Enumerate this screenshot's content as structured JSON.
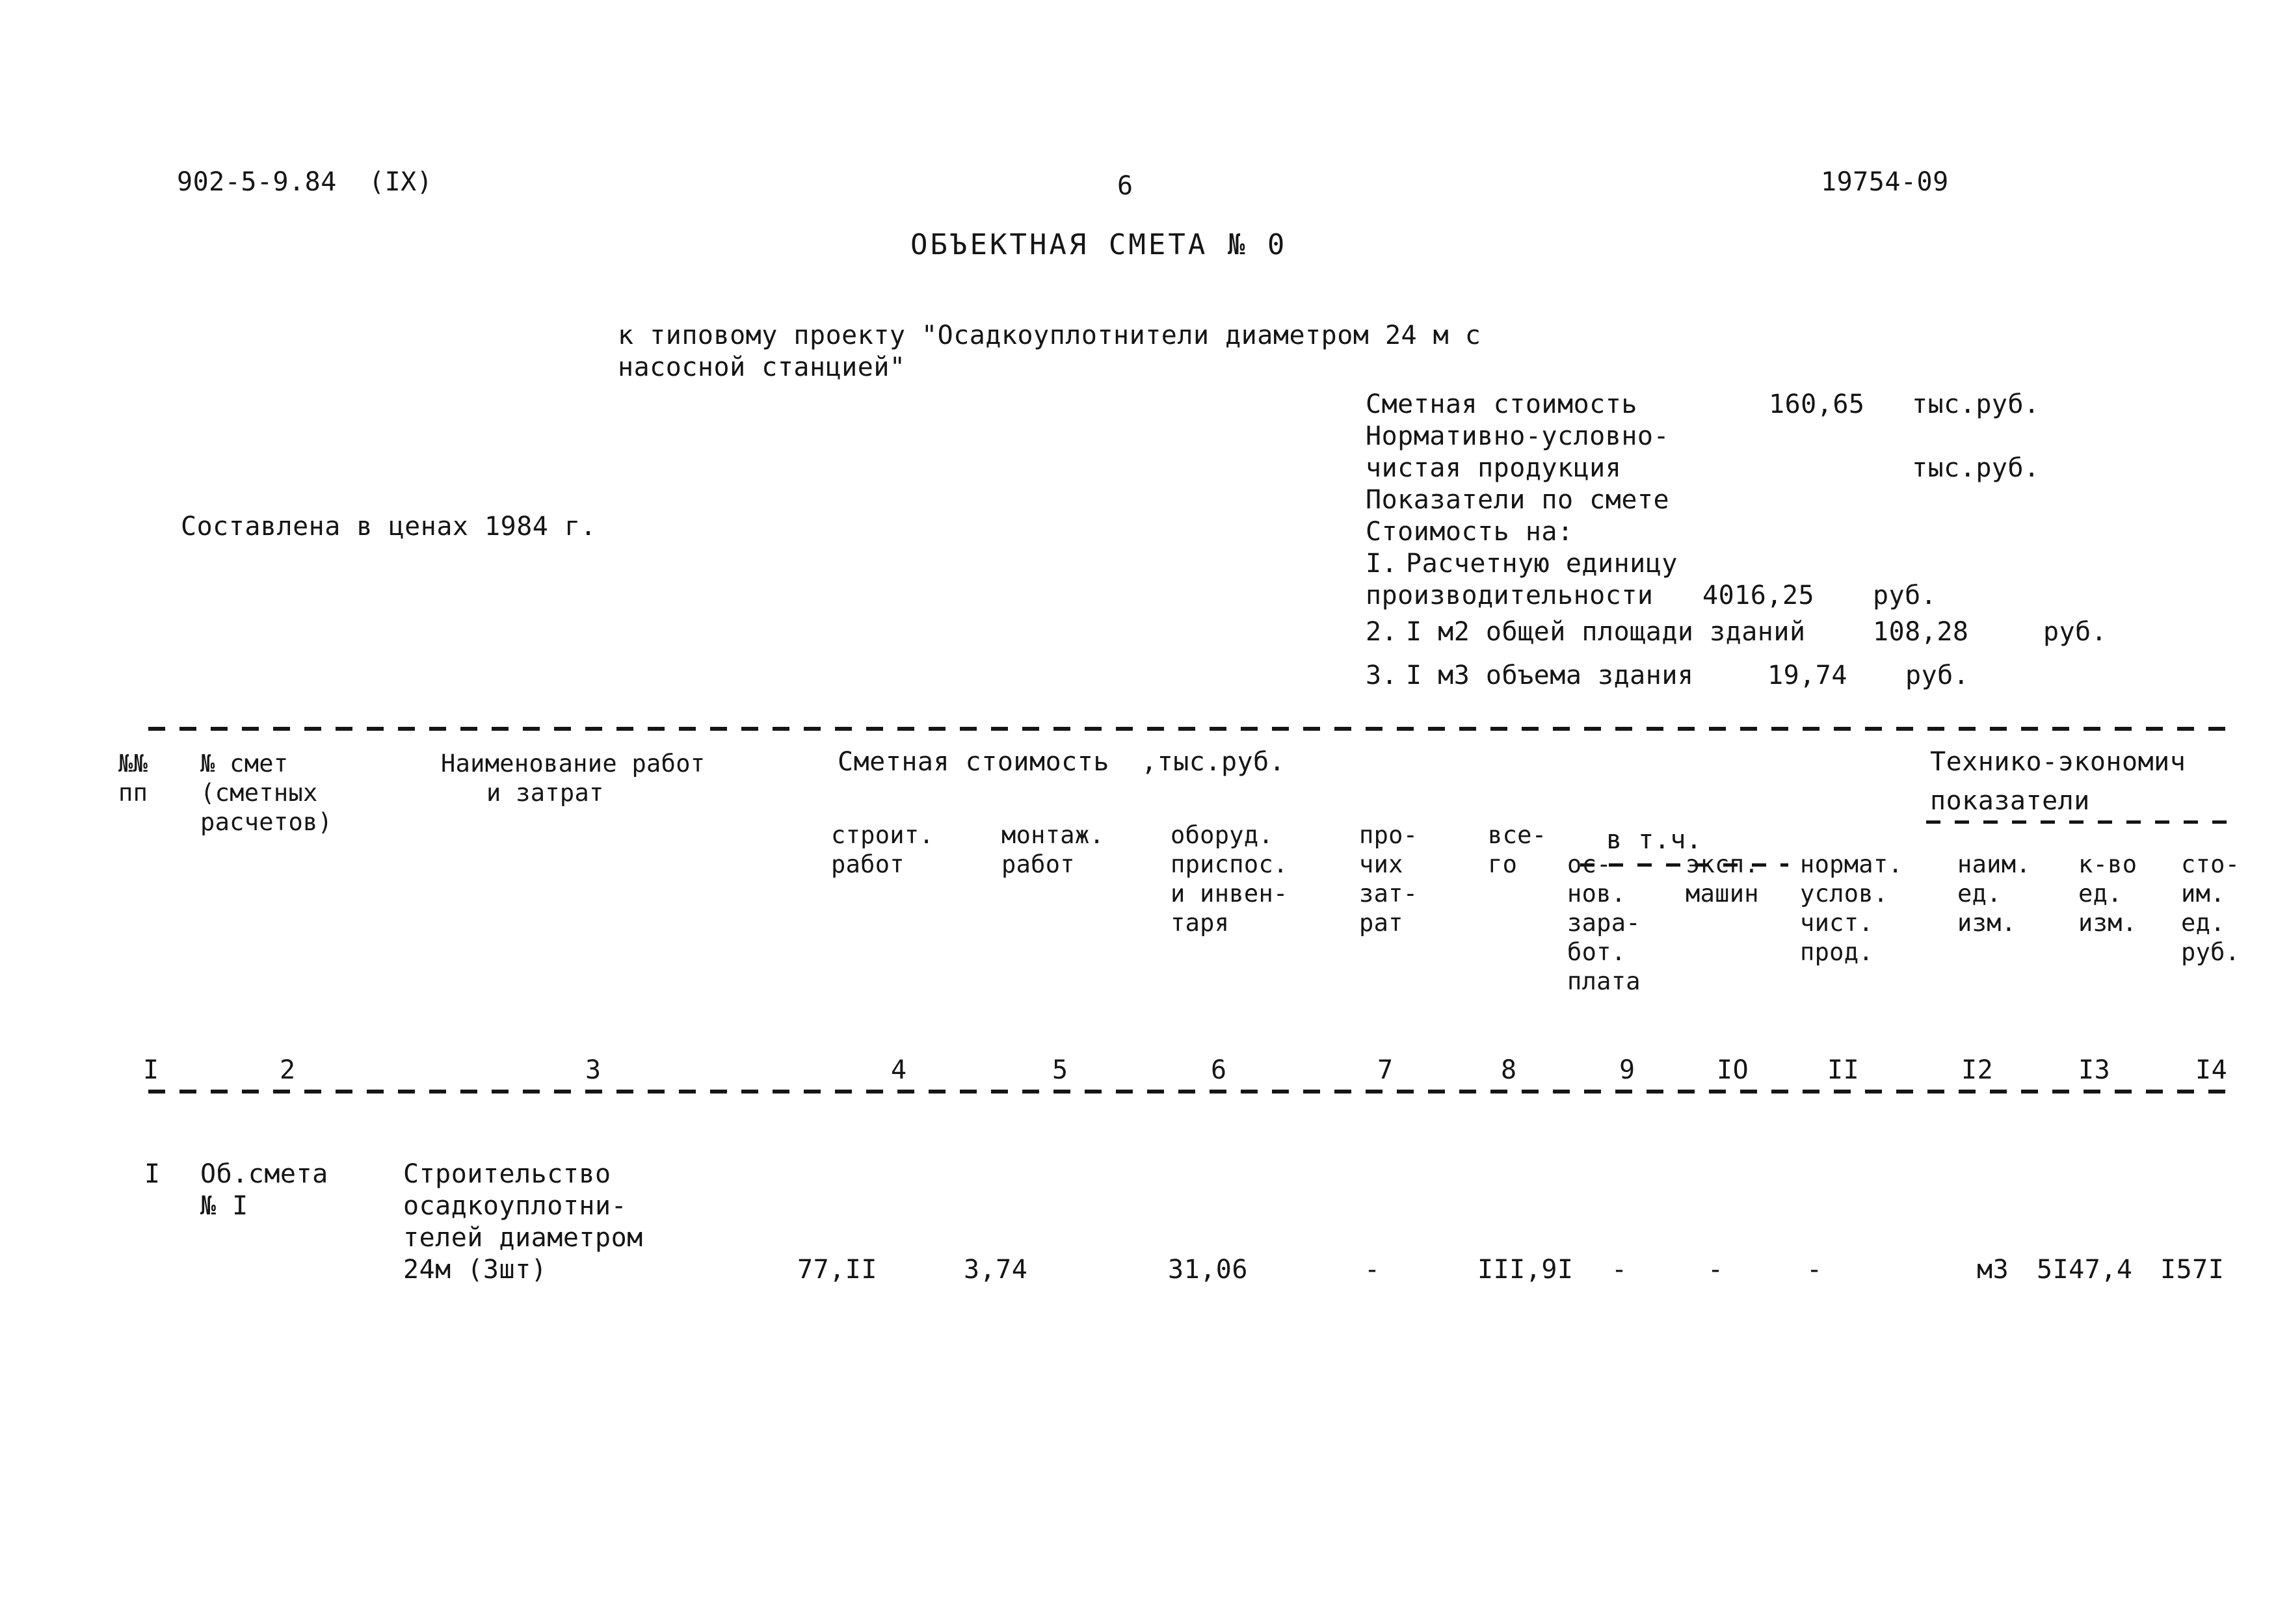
{
  "header": {
    "doc_code": "902-5-9.84  (IX)",
    "page_number": "6",
    "archive_code": "19754-09",
    "title": "ОБЪЕКТНАЯ СМЕТА № 0",
    "subtitle_line1": "к типовому проекту \"Осадкоуплотнители диаметром 24 м с",
    "subtitle_line2": "насосной станцией\"",
    "prices_note": "Составлена в ценах 1984 г."
  },
  "summary": {
    "estimate_cost_label": "Сметная стоимость",
    "estimate_cost_value": "160,65",
    "estimate_cost_unit": "тыс.руб.",
    "nucp_label_line1": "Нормативно-условно-",
    "nucp_label_line2": "чистая продукция",
    "nucp_value": "",
    "nucp_unit": "тыс.руб.",
    "indicators_label": "Показатели по смете",
    "cost_for_label": "Стоимость на:",
    "items": [
      {
        "no": "I.",
        "label_line1": "Расчетную единицу",
        "label_line2": "производительности",
        "value": "4016,25",
        "unit": "руб."
      },
      {
        "no": "2.",
        "label_line1": "I м2 общей площади зданий",
        "label_line2": "",
        "value": "108,28",
        "unit": "руб."
      },
      {
        "no": "3.",
        "label_line1": "I м3 объема здания",
        "label_line2": "",
        "value": "19,74",
        "unit": "руб."
      }
    ]
  },
  "table": {
    "group_headers": {
      "cost_group": "Сметная стоимость  ,тыс.руб.",
      "of_which": "в т.ч.",
      "tech_econ_line1": "Технико-экономич",
      "tech_econ_line2": "показатели"
    },
    "headers": {
      "c1_l1": "№№",
      "c1_l2": "пп",
      "c2_l1": "№ смет",
      "c2_l2": "(сметных",
      "c2_l3": "расчетов)",
      "c3_l1": "Наименование работ",
      "c3_l2": "и затрат",
      "c4_l1": "строит.",
      "c4_l2": "работ",
      "c5_l1": "монтаж.",
      "c5_l2": "работ",
      "c6_l1": "оборуд.",
      "c6_l2": "приспос.",
      "c6_l3": "и инвен-",
      "c6_l4": "таря",
      "c7_l1": "про-",
      "c7_l2": "чих",
      "c7_l3": "зат-",
      "c7_l4": "рат",
      "c8_l1": "все-",
      "c8_l2": "го",
      "c9_l1": "ос-",
      "c9_l2": "нов.",
      "c9_l3": "зара-",
      "c9_l4": "бот.",
      "c9_l5": "плата",
      "c10_l1": "эксп.",
      "c10_l2": "машин",
      "c11_l1": "нормат.",
      "c11_l2": "услов.",
      "c11_l3": "чист.",
      "c11_l4": "прод.",
      "c12_l1": "наим.",
      "c12_l2": "ед.",
      "c12_l3": "изм.",
      "c13_l1": "к-во",
      "c13_l2": "ед.",
      "c13_l3": "изм.",
      "c14_l1": "сто-",
      "c14_l2": "им.",
      "c14_l3": "ед.",
      "c14_l4": "руб."
    },
    "column_numbers": [
      "I",
      "2",
      "3",
      "4",
      "5",
      "6",
      "7",
      "8",
      "9",
      "IO",
      "II",
      "I2",
      "I3",
      "I4"
    ],
    "rows": [
      {
        "c1": "I",
        "c2_l1": "Об.смета",
        "c2_l2": "№ I",
        "c3_l1": "Строительство",
        "c3_l2": "осадкоуплотни-",
        "c3_l3": "телей диаметром",
        "c3_l4": "24м (3шт)",
        "c4": "77,II",
        "c5": "3,74",
        "c6": "31,06",
        "c7": "-",
        "c8": "III,9I",
        "c9": "-",
        "c10": "-",
        "c11": "-",
        "c12": "м3",
        "c13": "5I47,4",
        "c14": "I57I"
      }
    ]
  }
}
